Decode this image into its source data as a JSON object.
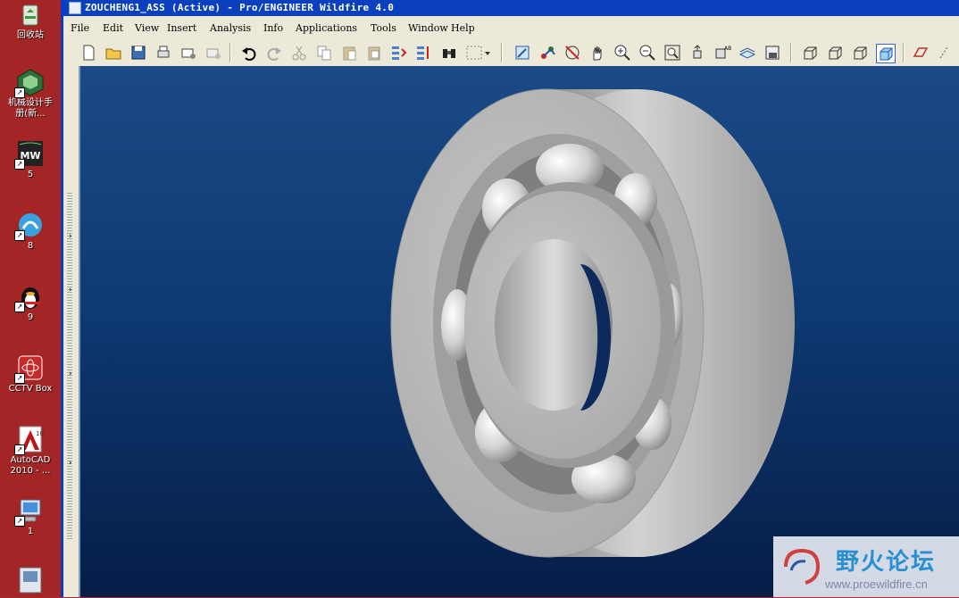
{
  "desktop": {
    "icons": [
      {
        "name": "recycle-bin",
        "label": "回收站"
      },
      {
        "name": "machine-design-handbook",
        "label": "机械设计手\n册(新..."
      },
      {
        "name": "mw-shortcut",
        "label": "5"
      },
      {
        "name": "shortcut-8",
        "label": "8"
      },
      {
        "name": "qq-shortcut",
        "label": "9"
      },
      {
        "name": "cctv-box",
        "label": "CCTV Box"
      },
      {
        "name": "autocad-2010",
        "label": "AutoCAD\n2010 - ..."
      },
      {
        "name": "my-computer",
        "label": "1"
      }
    ]
  },
  "window": {
    "title": "ZOUCHENG1_ASS (Active) - Pro/ENGINEER Wildfire 4.0",
    "menus": [
      "File",
      "Edit",
      "View",
      "Insert",
      "Analysis",
      "Info",
      "Applications",
      "Tools",
      "Window",
      "Help"
    ]
  },
  "watermark": {
    "cn": "野火论坛",
    "url": "www.proewildfire.cn"
  },
  "colors": {
    "title_bar": "#0a3fbd",
    "viewport_top": "#1b4a86",
    "viewport_bottom": "#061d47",
    "desktop": "#a32525"
  }
}
